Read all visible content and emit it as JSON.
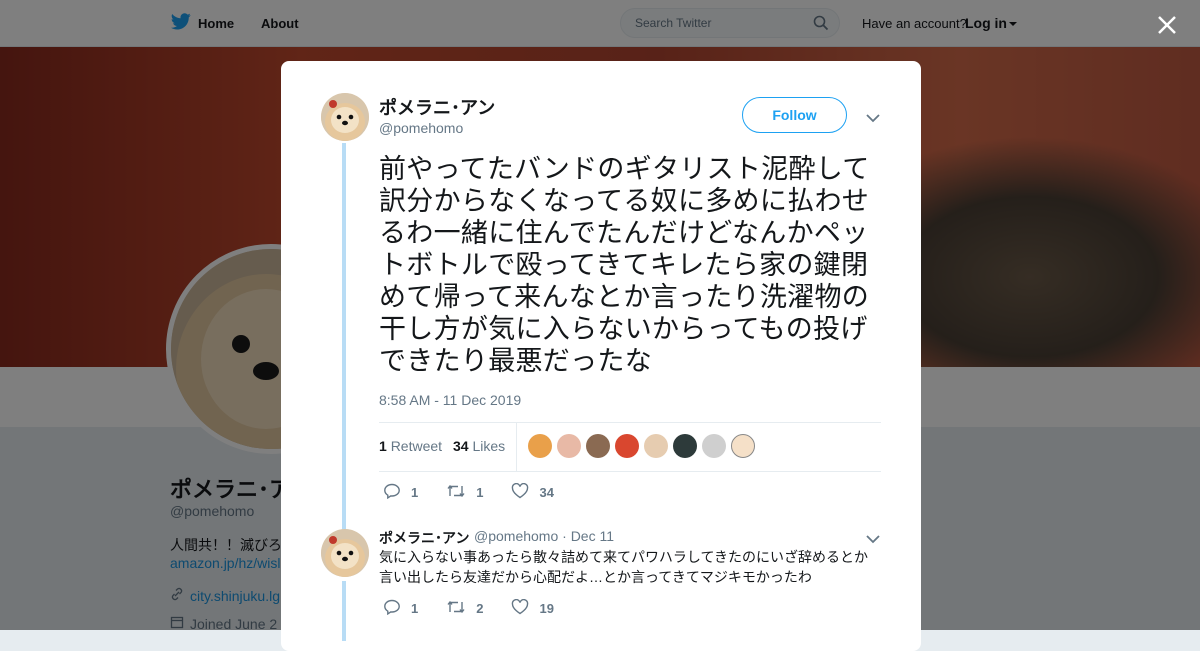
{
  "nav": {
    "home_label": "Home",
    "about_label": "About",
    "search_placeholder": "Search Twitter",
    "have_account": "Have an account?",
    "login_label": "Log in"
  },
  "profile": {
    "name": "ポメラニ･ア",
    "handle": "@pomehomo",
    "bio": "人間共！！滅びろ",
    "link": "amazon.jp/hz/wisl",
    "location": "city.shinjuku.lg",
    "joined": "Joined June 2"
  },
  "tweet": {
    "name": "ポメラニ･アン",
    "handle": "@pomehomo",
    "follow_label": "Follow",
    "text": "前やってたバンドのギタリスト泥酔して訳分からなくなってる奴に多めに払わせるわ一緒に住んでたんだけどなんかペットボトルで殴ってきてキレたら家の鍵閉めて帰って来んなとか言ったり洗濯物の干し方が気に入らないからってもの投げできたり最悪だったな",
    "timestamp": "8:58 AM - 11 Dec 2019",
    "retweet_count": "1",
    "retweet_label": "Retweet",
    "like_count": "34",
    "like_label": "Likes",
    "actions": {
      "replies": "1",
      "retweets": "1",
      "likes": "34"
    }
  },
  "reply": {
    "name": "ポメラニ･アン",
    "meta": "@pomehomo · Dec 11",
    "text": "気に入らない事あったら散々詰めて来てパワハラしてきたのにいざ辞めるとか言い出したら友達だから心配だよ…とか言ってきてマジキモかったわ",
    "actions": {
      "replies": "1",
      "retweets": "2",
      "likes": "19"
    }
  },
  "colors": {
    "accent": "#1da1f2",
    "text_primary": "#14171a",
    "text_secondary": "#657786",
    "thread_line": "#b8dcf5"
  }
}
